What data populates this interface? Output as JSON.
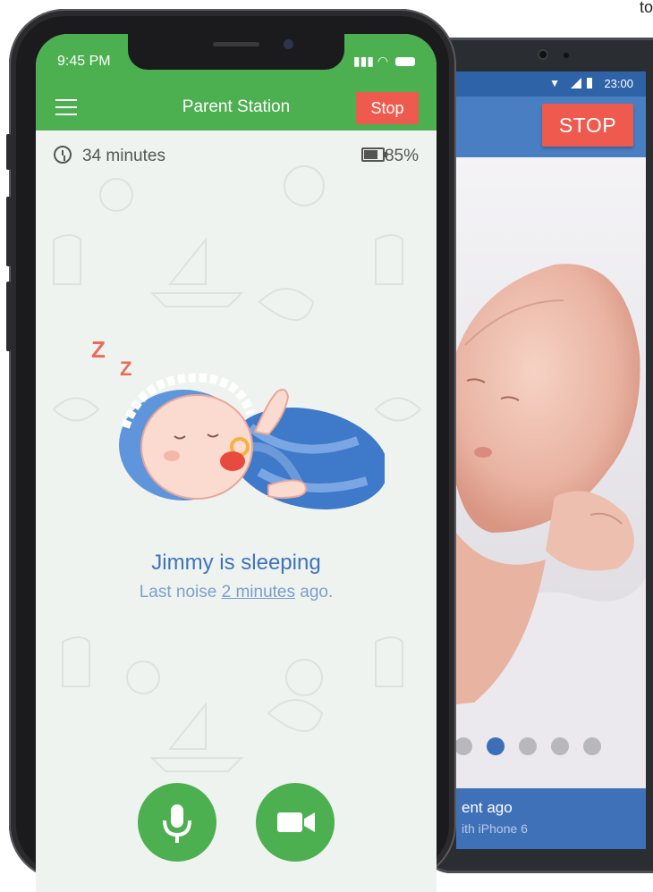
{
  "corner_text": "to",
  "android": {
    "status_time": "23:00",
    "stop_label": "STOP",
    "footer_line1": "ent ago",
    "footer_line2": "ith  iPhone 6",
    "dots": {
      "count": 6,
      "active": 1
    }
  },
  "iphone": {
    "status_time": "9:45 PM",
    "title": "Parent Station",
    "stop_label": "Stop",
    "duration": "34 minutes",
    "battery_pct": "85%",
    "status_main": "Jimmy is sleeping",
    "status_sub_prefix": "Last noise ",
    "status_sub_link": "2 minutes",
    "status_sub_suffix": " ago."
  },
  "colors": {
    "green": "#4caf50",
    "stop_red": "#ef5a4e",
    "android_blue": "#4a7ec3",
    "status_blue": "#3f73bd"
  },
  "icons": [
    "menu-icon",
    "clock-icon",
    "battery-icon",
    "microphone-icon",
    "video-camera-icon",
    "pacifier-icon"
  ]
}
